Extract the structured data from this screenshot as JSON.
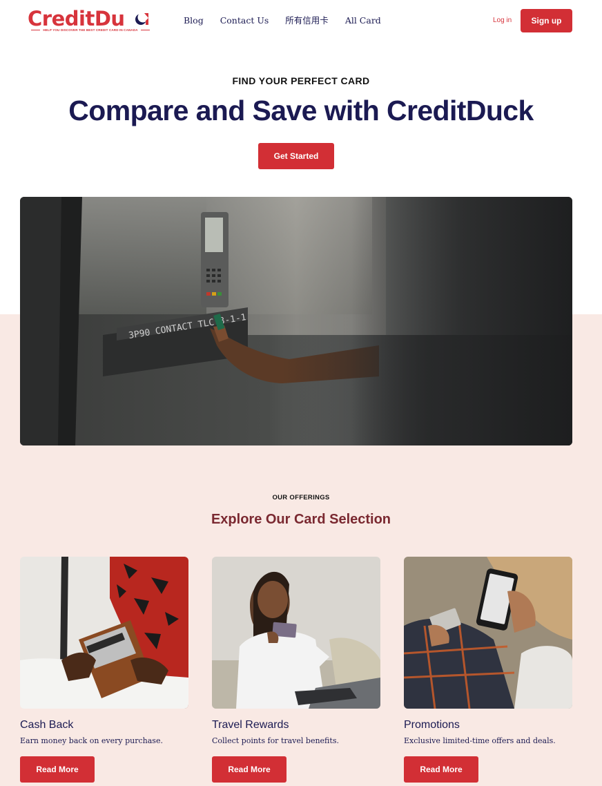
{
  "brand": {
    "name": "CreditDu",
    "tagline": "HELP YOU DISCOVER THE BEST CREDIT CARD IN CANADA",
    "accent": "#d22f35",
    "navy": "#1b1a52",
    "band_color": "#f9e9e4"
  },
  "nav": {
    "items": [
      "Blog",
      "Contact Us",
      "所有信用卡",
      "All Card"
    ],
    "login": "Log in",
    "signup": "Sign up"
  },
  "hero": {
    "eyebrow": "FIND YOUR PERFECT CARD",
    "title": "Compare and Save with CreditDuck",
    "cta": "Get Started",
    "image_text": "3P90 CONTACT  TLC  3-1-1"
  },
  "offerings": {
    "eyebrow": "OUR OFFERINGS",
    "title": "Explore Our Card Selection",
    "cards": [
      {
        "title": "Cash Back",
        "desc": "Earn money back on every purchase.",
        "button": "Read More",
        "icon": "wallet-photo"
      },
      {
        "title": "Travel Rewards",
        "desc": "Collect points for travel benefits.",
        "button": "Read More",
        "icon": "woman-card-photo"
      },
      {
        "title": "Promotions",
        "desc": "Exclusive limited-time offers and deals.",
        "button": "Read More",
        "icon": "phone-card-photo"
      }
    ]
  }
}
